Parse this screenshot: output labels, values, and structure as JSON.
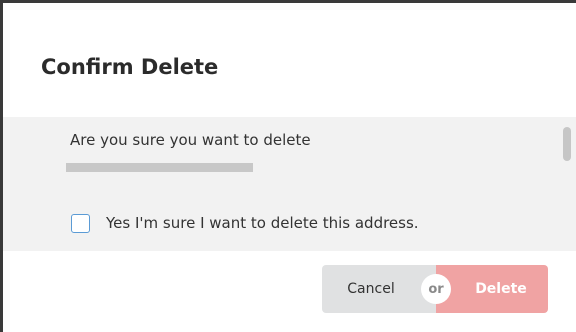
{
  "dialog": {
    "title": "Confirm Delete",
    "message": "Are you sure you want to delete",
    "confirm_checkbox": {
      "label": "Yes I'm sure I want to delete this address.",
      "checked": false
    },
    "buttons": {
      "cancel_label": "Cancel",
      "or_label": "or",
      "delete_label": "Delete"
    }
  },
  "colors": {
    "panel_background": "#f2f2f2",
    "cancel_background": "#e0e1e2",
    "delete_background": "#f0a3a3",
    "checkbox_border": "#5b9bd5"
  }
}
